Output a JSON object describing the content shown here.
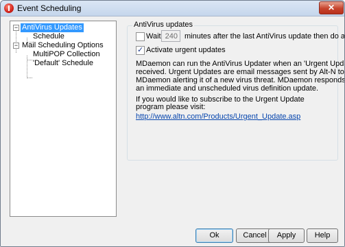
{
  "window": {
    "title": "Event Scheduling"
  },
  "tree": {
    "items": [
      {
        "label": "AntiVirus Updates"
      },
      {
        "label": "Schedule"
      },
      {
        "label": "Mail Scheduling Options"
      },
      {
        "label": "MultiPOP Collection"
      },
      {
        "label": "'Default' Schedule"
      }
    ]
  },
  "antivirus": {
    "group_label": "AntiVirus updates",
    "wait_label": "Wait",
    "wait_value": "240",
    "wait_suffix": "minutes after the last AntiVirus update then do another",
    "urgent_label": "Activate urgent updates",
    "paragraph_lines": [
      "MDaemon can run the AntiVirus Updater when an 'Urgent Update' message is",
      "received.  Urgent Updates are email messages sent by Alt-N to your",
      "MDaemon alerting it of a new virus threat.  MDaemon responds by triggering",
      "an immediate and unscheduled virus definition update."
    ],
    "subscribe_lines": [
      "If you would like to subscribe to the Urgent Update",
      "program please visit:"
    ],
    "link": "http://www.altn.com/Products/Urgent_Update.asp"
  },
  "buttons": {
    "ok": "Ok",
    "cancel": "Cancel",
    "apply": "Apply",
    "help": "Help"
  }
}
